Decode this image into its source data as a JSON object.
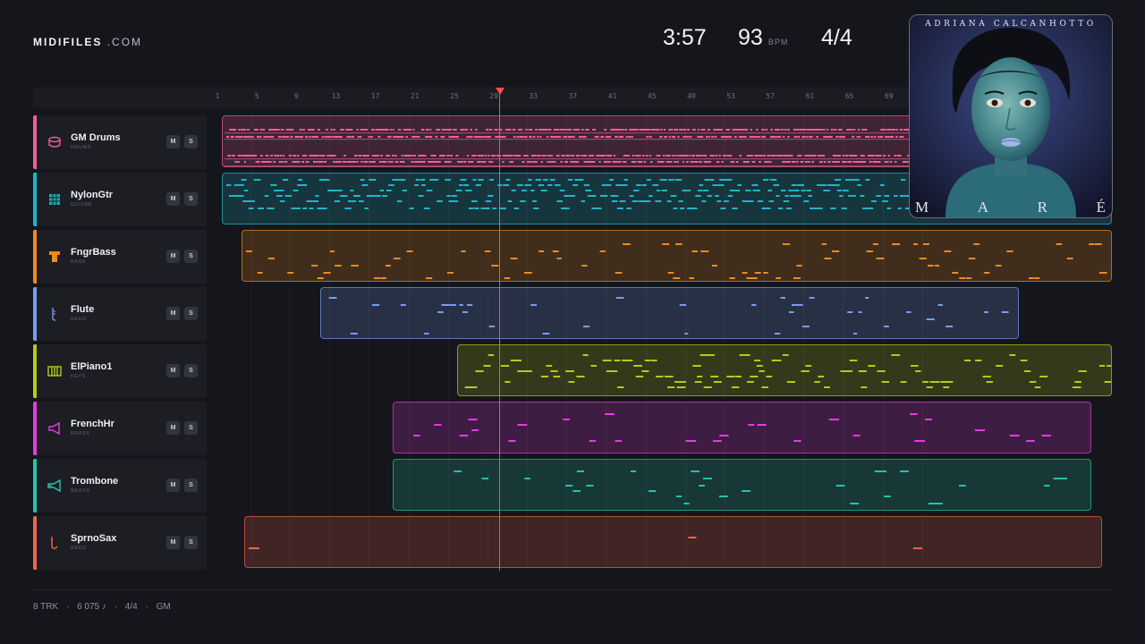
{
  "brand": {
    "name": "MIDIFILES",
    "suffix": ".COM"
  },
  "header": {
    "time": "3:57",
    "tempo": "93",
    "tempo_unit": "BPM",
    "meter": "4/4"
  },
  "ruler": {
    "marks": [
      "1",
      "5",
      "9",
      "13",
      "17",
      "21",
      "25",
      "29",
      "33",
      "37",
      "41",
      "45",
      "49",
      "53",
      "57",
      "61",
      "65",
      "69"
    ],
    "playhead_bar": 29
  },
  "album": {
    "artist": "ADRIANA CALCANHOTTO",
    "title_letters": [
      "M",
      "A",
      "R",
      "É"
    ]
  },
  "tracks": [
    {
      "name": "GM Drums",
      "category": "DRUMS",
      "color": "#f0609a",
      "icon": "drum-icon"
    },
    {
      "name": "NylonGtr",
      "category": "GUITAR",
      "color": "#1fb6c9",
      "icon": "guitar-icon"
    },
    {
      "name": "FngrBass",
      "category": "BASS",
      "color": "#f08a1f",
      "icon": "bass-icon"
    },
    {
      "name": "Flute",
      "category": "REED",
      "color": "#7a9cf0",
      "icon": "flute-icon"
    },
    {
      "name": "ElPiano1",
      "category": "KEYS",
      "color": "#b5c91f",
      "icon": "piano-icon"
    },
    {
      "name": "FrenchHr",
      "category": "BRASS",
      "color": "#e43ce0",
      "icon": "horn-icon"
    },
    {
      "name": "Trombone",
      "category": "BRASS",
      "color": "#25c4a8",
      "icon": "trombone-icon"
    },
    {
      "name": "SprnoSax",
      "category": "REED",
      "color": "#f0654c",
      "icon": "sax-icon"
    }
  ],
  "buttons": {
    "mute": "M",
    "solo": "S"
  },
  "footer": {
    "tracks": "8 TRK",
    "sep": "·",
    "notes": "6 075 ♪",
    "meter": "4/4",
    "standard": "GM"
  }
}
